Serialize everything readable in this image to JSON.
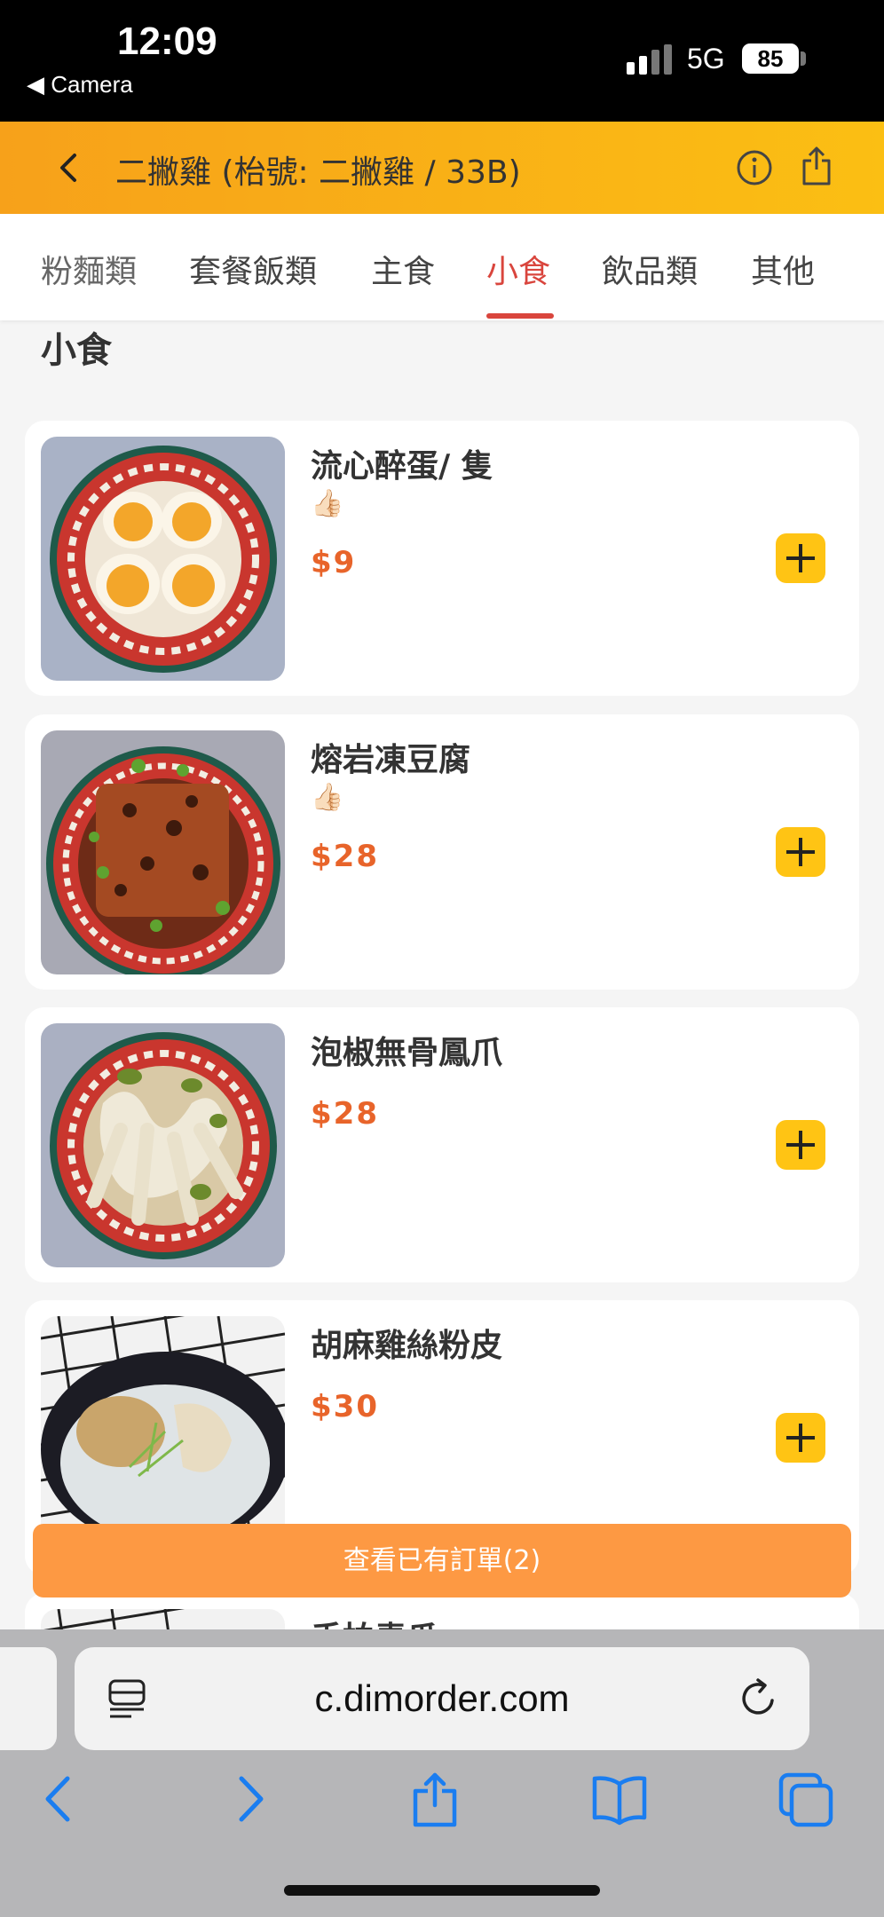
{
  "status_bar": {
    "time": "12:09",
    "back_app": "◀ Camera",
    "network": "5G",
    "battery": "85"
  },
  "header": {
    "title": "二撇雞 (枱號: 二撇雞 / 33B)"
  },
  "tabs": [
    {
      "label": "粉麵類"
    },
    {
      "label": "套餐飯類"
    },
    {
      "label": "主食"
    },
    {
      "label": "小食",
      "active": true
    },
    {
      "label": "飲品類"
    },
    {
      "label": "其他"
    }
  ],
  "section_title": "小食",
  "items": [
    {
      "name": "流心醉蛋/ 隻",
      "emoji": "👍🏻",
      "price": "$9"
    },
    {
      "name": "熔岩凍豆腐",
      "emoji": "👍🏻",
      "price": "$28"
    },
    {
      "name": "泡椒無骨鳳爪",
      "price": "$28"
    },
    {
      "name": "胡麻雞絲粉皮",
      "price": "$30"
    },
    {
      "name": "手拍青瓜"
    }
  ],
  "order_bar": {
    "label": "查看已有訂單(2)"
  },
  "browser": {
    "url": "c.dimorder.com"
  },
  "colors": {
    "accent": "#d9453d",
    "price": "#e8642a",
    "add_button": "#ffc414",
    "order_bar": "#fd9943",
    "header_start": "#f7a11a",
    "header_end": "#fbbf13"
  }
}
